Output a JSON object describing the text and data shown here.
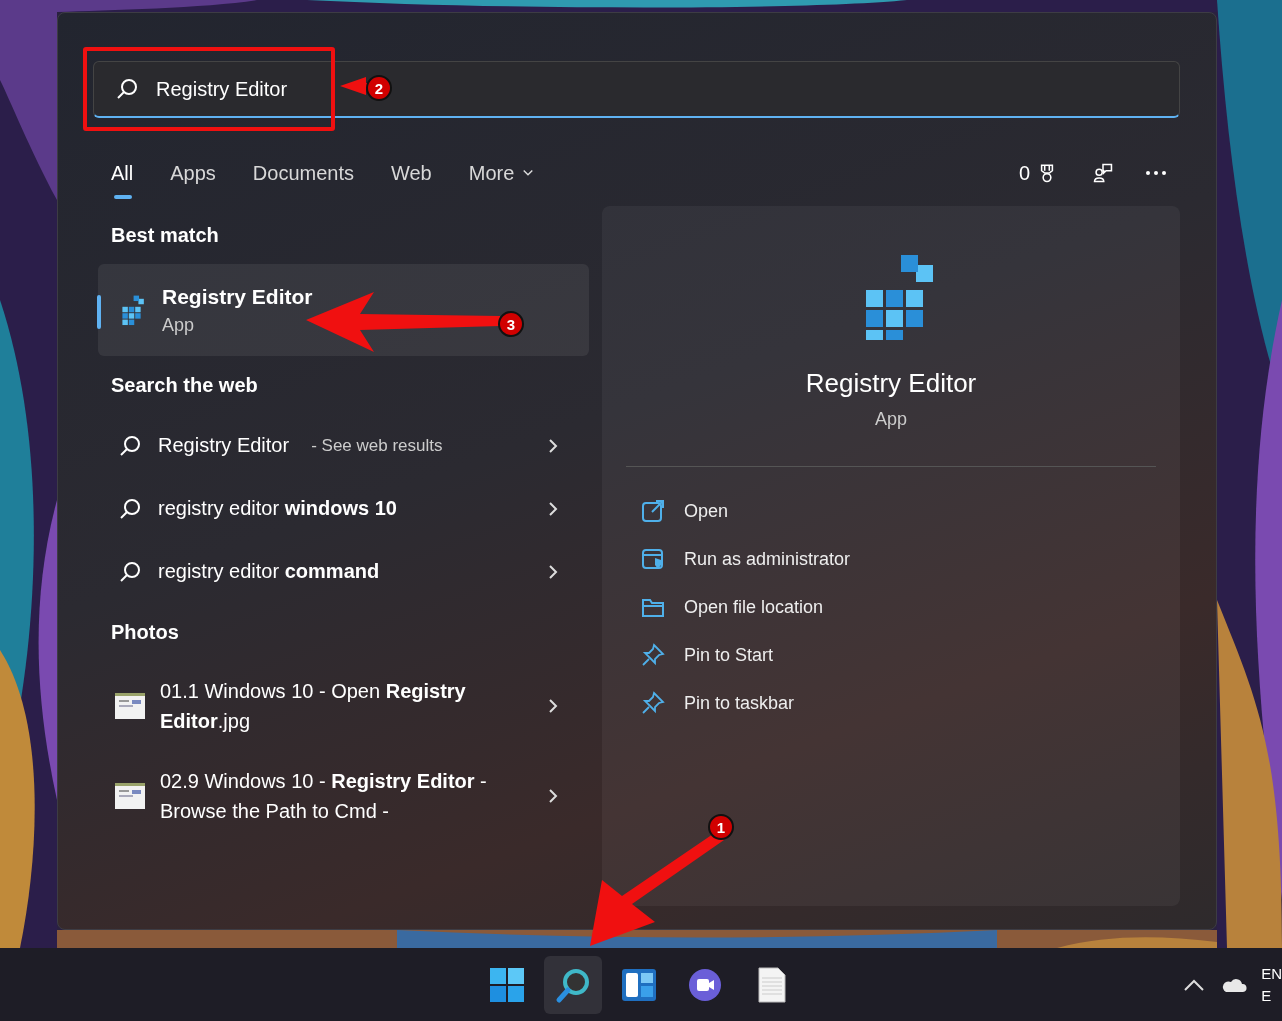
{
  "search": {
    "value": "Registry Editor"
  },
  "tabs": [
    {
      "label": "All",
      "selected": true,
      "kind": "plain"
    },
    {
      "label": "Apps",
      "selected": false,
      "kind": "plain"
    },
    {
      "label": "Documents",
      "selected": false,
      "kind": "plain"
    },
    {
      "label": "Web",
      "selected": false,
      "kind": "plain"
    },
    {
      "label": "More",
      "selected": false,
      "kind": "dropdown"
    }
  ],
  "toolbar": {
    "points": "0"
  },
  "best_match": {
    "heading": "Best match",
    "item": {
      "title": "Registry Editor",
      "subtitle": "App",
      "selected": true
    }
  },
  "search_web": {
    "heading": "Search the web",
    "items": [
      {
        "text": "Registry Editor",
        "hint": "- See web results"
      },
      {
        "text": "registry editor **windows 10**"
      },
      {
        "text": "registry editor **command**"
      }
    ]
  },
  "photos": {
    "heading": "Photos",
    "items": [
      {
        "text": "01.1 Windows 10 - Open **Registry Editor**.jpg"
      },
      {
        "text": "02.9 Windows 10 - **Registry Editor** - Browse the Path to Cmd -"
      }
    ]
  },
  "detail": {
    "title": "Registry Editor",
    "subtitle": "App",
    "actions": [
      {
        "label": "Open",
        "kind": "open"
      },
      {
        "label": "Run as administrator",
        "kind": "admin"
      },
      {
        "label": "Open file location",
        "kind": "folder"
      },
      {
        "label": "Pin to Start",
        "kind": "pin"
      },
      {
        "label": "Pin to taskbar",
        "kind": "pin"
      }
    ]
  },
  "taskbar": {
    "apps": [
      {
        "kind": "start",
        "selected": false
      },
      {
        "kind": "search",
        "selected": true
      },
      {
        "kind": "widgets",
        "selected": false
      },
      {
        "kind": "chat",
        "selected": false
      },
      {
        "kind": "notepad",
        "selected": false
      }
    ],
    "tray_text": [
      "EN",
      "E"
    ]
  },
  "annotations": [
    {
      "number": "2"
    },
    {
      "number": "3"
    },
    {
      "number": "1"
    }
  ]
}
